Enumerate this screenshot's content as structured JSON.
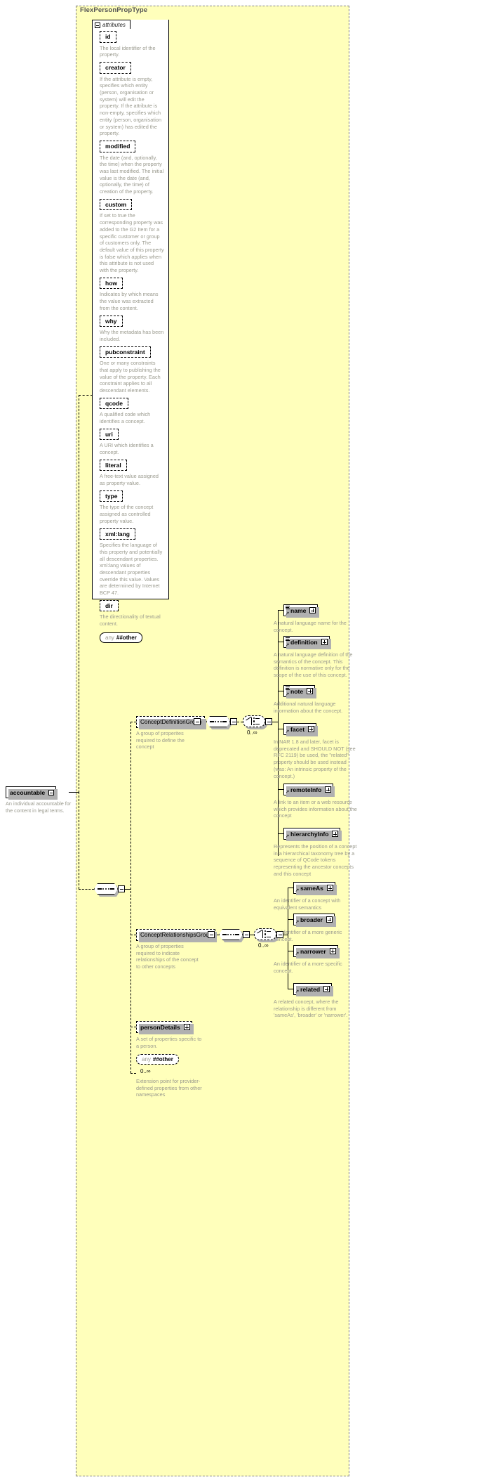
{
  "diagram": {
    "type_name": "FlexPersonPropType",
    "attributes_panel_label": "attributes"
  },
  "attributes": [
    {
      "name": "id",
      "desc": "The local identifier of the property."
    },
    {
      "name": "creator",
      "desc": "If the attribute is empty, specifies which entity (person, organisation or system) will edit the property. If the attribute is non-empty, specifies which entity (person, organisation or system) has edited the property."
    },
    {
      "name": "modified",
      "desc": "The date (and, optionally, the time) when the property was last modified. The initial value is the date (and, optionally, the time) of creation of the property."
    },
    {
      "name": "custom",
      "desc": "If set to true the corresponding property was added to the G2 Item for a specific customer or group of customers only. The default value of this property is false which applies when this attribute is not used with the property."
    },
    {
      "name": "how",
      "desc": "Indicates by which means the value was extracted from the content."
    },
    {
      "name": "why",
      "desc": "Why the metadata has been included."
    },
    {
      "name": "pubconstraint",
      "desc": "One or many constraints that apply to publishing the value of the property. Each constraint applies to all descendant elements."
    },
    {
      "name": "qcode",
      "desc": "A qualified code which identifies a concept."
    },
    {
      "name": "uri",
      "desc": "A URI which identifies a concept."
    },
    {
      "name": "literal",
      "desc": "A free-text value assigned as property value."
    },
    {
      "name": "type",
      "desc": "The type of the concept assigned as controlled property value."
    },
    {
      "name": "xml:lang",
      "desc": "Specifies the language of this property and potentially all descendant properties. xml:lang values of descendant properties override this value. Values are determined by Internet BCP 47."
    },
    {
      "name": "dir",
      "desc": "The directionality of textual content."
    }
  ],
  "attributes_any": {
    "keyword": "any",
    "namespace": "##other"
  },
  "root_element": {
    "name": "accountable",
    "desc": "An individual accountable for the content in legal terms."
  },
  "groups": [
    {
      "name": "ConceptDefinitionGroup",
      "desc": "A group of properites required to define the concept",
      "cardinality": "0..∞",
      "children": [
        {
          "name": "name",
          "desc": "A natural language name for the concept."
        },
        {
          "name": "definition",
          "desc": "A natural language definition of the semantics of the concept. This definition is normative only for the scope of the use of this concept."
        },
        {
          "name": "note",
          "desc": "Additional natural language information about the concept."
        },
        {
          "name": "facet",
          "desc": "In NAR 1.8 and later, facet is deprecated and SHOULD NOT (see RFC 2119) be used, the \"related\" property should be used instead (was: An intrinsic property of the concept.)"
        },
        {
          "name": "remoteInfo",
          "desc": "A link to an item or a web resource which provides information about the concept"
        },
        {
          "name": "hierarchyInfo",
          "desc": "Represents the position of a concept in a hierarchical taxonomy tree by a sequence of QCode tokens representing the ancestor concepts and this concept"
        }
      ]
    },
    {
      "name": "ConceptRelationshipsGroup",
      "desc": "A group of properties required to indicate relationships of the concept to other concepts",
      "cardinality": "0..∞",
      "children": [
        {
          "name": "sameAs",
          "desc": "An identifier of a concept with equivalent semantics"
        },
        {
          "name": "broader",
          "desc": "An identifier of a more generic concept."
        },
        {
          "name": "narrower",
          "desc": "An identifier of a more specific concept."
        },
        {
          "name": "related",
          "desc": "A related concept, where the relationship is different from 'sameAs', 'broader' or 'narrower'."
        }
      ]
    }
  ],
  "tail_elements": [
    {
      "name": "personDetails",
      "desc": "A set of properties specific to a person."
    }
  ],
  "tail_any": {
    "keyword": "any",
    "namespace": "##other",
    "cardinality": "0..∞",
    "desc": "Extension point for provider-defined properties from other namespaces"
  },
  "colors": {
    "type_background": "#ffffbb",
    "description_text": "#9a9a8e",
    "title_text": "#555555",
    "shadow": "#b0b0b0"
  }
}
